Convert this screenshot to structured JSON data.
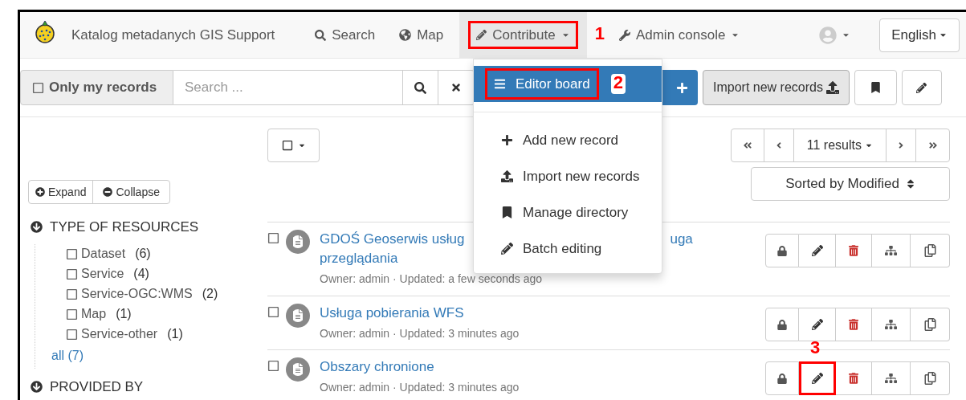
{
  "navbar": {
    "brand": "Katalog metadanych GIS Support",
    "items": [
      {
        "label": "Search",
        "kind": "search",
        "selected": false,
        "dropdown": false
      },
      {
        "label": "Map",
        "kind": "map",
        "selected": false,
        "dropdown": false
      },
      {
        "label": "Contribute",
        "kind": "contribute",
        "selected": true,
        "dropdown": true,
        "annotation": "1"
      },
      {
        "label": "Admin console",
        "kind": "admin",
        "selected": false,
        "dropdown": true
      }
    ],
    "language": "English"
  },
  "toolbar": {
    "only_my_records": {
      "label": "Only my records",
      "checked": false
    },
    "search": {
      "placeholder": "Search ..."
    },
    "import_button": "Import new records"
  },
  "contribute_menu": {
    "items": [
      {
        "label": "Editor board",
        "kind": "bars",
        "selected": true,
        "annotation": "2"
      },
      {
        "label": "Add new record",
        "kind": "plus",
        "selected": false
      },
      {
        "label": "Import new records",
        "kind": "upload",
        "selected": false
      },
      {
        "label": "Manage directory",
        "kind": "bookmark",
        "selected": false
      },
      {
        "label": "Batch editing",
        "kind": "pencil",
        "selected": false
      }
    ]
  },
  "facets": {
    "expand": "Expand",
    "collapse": "Collapse",
    "groups": [
      {
        "title": "TYPE OF RESOURCES",
        "expanded": true,
        "items": [
          {
            "label": "Dataset",
            "count": "(6)",
            "checked": false
          },
          {
            "label": "Service",
            "count": "(4)",
            "checked": false
          },
          {
            "label": "Service-OGC:WMS",
            "count": "(2)",
            "checked": false
          },
          {
            "label": "Map",
            "count": "(1)",
            "checked": false
          },
          {
            "label": "Service-other",
            "count": "(1)",
            "checked": false
          }
        ],
        "all": "all (7)"
      },
      {
        "title": "PROVIDED BY",
        "expanded": true
      }
    ]
  },
  "results": {
    "count": "11 results",
    "sort": "Sorted by Modified",
    "records": [
      {
        "title": "GDOŚ Geoserwis usług",
        "title_after_menu": "uga",
        "title_line2": "przeglądania",
        "meta": "Owner: admin · Updated: a few seconds ago",
        "checked": false
      },
      {
        "title": "Usługa pobierania WFS",
        "meta": "Owner: admin · Updated: 3 minutes ago",
        "checked": false
      },
      {
        "title": "Obszary chronione",
        "meta": "Owner: admin · Updated: 3 minutes ago",
        "checked": false,
        "edit_annotation": "3"
      }
    ]
  }
}
